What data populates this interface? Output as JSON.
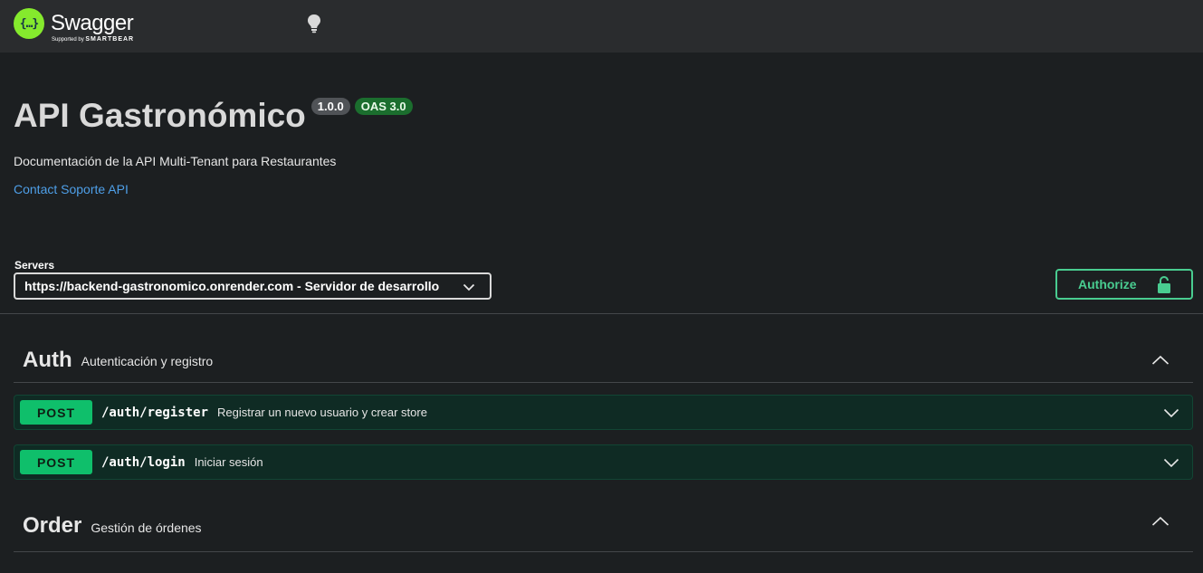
{
  "topbar": {
    "logo_symbol": "{…}",
    "logo_text": "Swagger",
    "logo_sub_prefix": "Supported by",
    "logo_sub_brand": "SMARTBEAR",
    "theme_icon": "lightbulb-icon"
  },
  "info": {
    "title": "API Gastronómico",
    "version": "1.0.0",
    "oas": "OAS 3.0",
    "description": "Documentación de la API Multi-Tenant para Restaurantes",
    "contact_label": "Contact Soporte API"
  },
  "servers": {
    "label": "Servers",
    "selected": "https://backend-gastronomico.onrender.com - Servidor de desarrollo"
  },
  "authorize": {
    "label": "Authorize",
    "icon": "lock-open-icon"
  },
  "tags": [
    {
      "name": "Auth",
      "description": "Autenticación y registro",
      "operations": [
        {
          "method": "POST",
          "path": "/auth/register",
          "summary": "Registrar un nuevo usuario y crear store"
        },
        {
          "method": "POST",
          "path": "/auth/login",
          "summary": "Iniciar sesión"
        }
      ]
    },
    {
      "name": "Order",
      "description": "Gestión de órdenes",
      "operations": []
    }
  ],
  "colors": {
    "post": "#0fbf6b",
    "authorize": "#49cc90",
    "logo": "#85ea2d",
    "link": "#4e9fe8"
  }
}
